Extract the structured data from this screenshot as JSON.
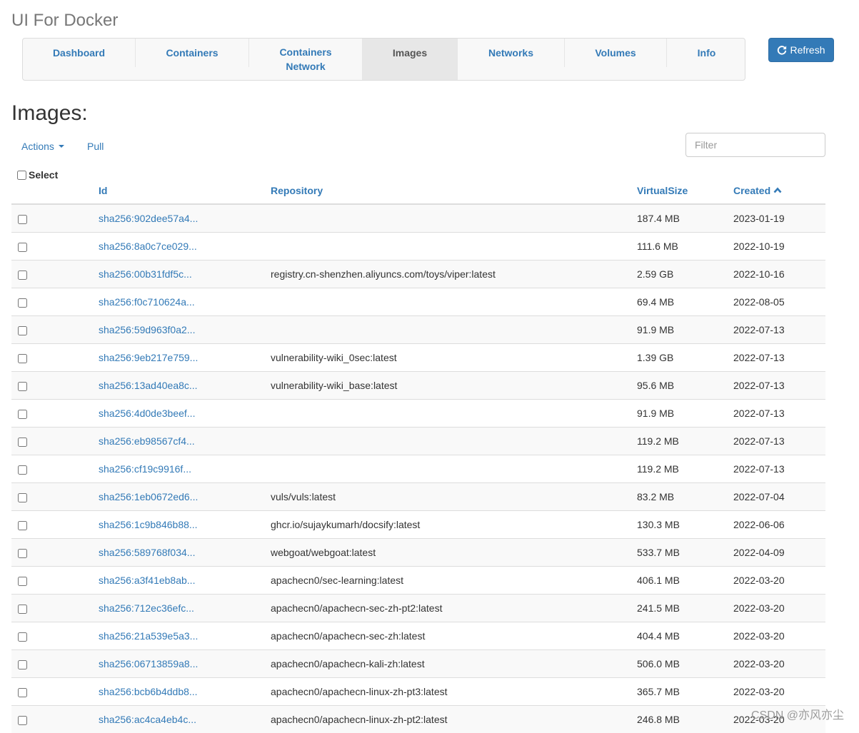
{
  "app": {
    "brand": "UI For Docker"
  },
  "nav": {
    "tabs": [
      {
        "label": "Dashboard"
      },
      {
        "label": "Containers"
      },
      {
        "label": "Containers Network"
      },
      {
        "label": "Images"
      },
      {
        "label": "Networks"
      },
      {
        "label": "Volumes"
      },
      {
        "label": "Info"
      }
    ],
    "active": "Images",
    "refresh_label": "Refresh"
  },
  "page": {
    "title": "Images:"
  },
  "toolbar": {
    "actions_label": "Actions",
    "pull_label": "Pull",
    "filter_placeholder": "Filter"
  },
  "table": {
    "headers": {
      "select": "Select",
      "id": "Id",
      "repository": "Repository",
      "size": "VirtualSize",
      "created": "Created"
    },
    "sort": {
      "column": "Created",
      "direction": "ascending"
    },
    "rows": [
      {
        "id": "sha256:902dee57a4...",
        "repository": "",
        "size": "187.4 MB",
        "created": "2023-01-19"
      },
      {
        "id": "sha256:8a0c7ce029...",
        "repository": "",
        "size": "111.6 MB",
        "created": "2022-10-19"
      },
      {
        "id": "sha256:00b31fdf5c...",
        "repository": "registry.cn-shenzhen.aliyuncs.com/toys/viper:latest",
        "size": "2.59 GB",
        "created": "2022-10-16"
      },
      {
        "id": "sha256:f0c710624a...",
        "repository": "",
        "size": "69.4 MB",
        "created": "2022-08-05"
      },
      {
        "id": "sha256:59d963f0a2...",
        "repository": "",
        "size": "91.9 MB",
        "created": "2022-07-13"
      },
      {
        "id": "sha256:9eb217e759...",
        "repository": "vulnerability-wiki_0sec:latest",
        "size": "1.39 GB",
        "created": "2022-07-13"
      },
      {
        "id": "sha256:13ad40ea8c...",
        "repository": "vulnerability-wiki_base:latest",
        "size": "95.6 MB",
        "created": "2022-07-13"
      },
      {
        "id": "sha256:4d0de3beef...",
        "repository": "",
        "size": "91.9 MB",
        "created": "2022-07-13"
      },
      {
        "id": "sha256:eb98567cf4...",
        "repository": "",
        "size": "119.2 MB",
        "created": "2022-07-13"
      },
      {
        "id": "sha256:cf19c9916f...",
        "repository": "",
        "size": "119.2 MB",
        "created": "2022-07-13"
      },
      {
        "id": "sha256:1eb0672ed6...",
        "repository": "vuls/vuls:latest",
        "size": "83.2 MB",
        "created": "2022-07-04"
      },
      {
        "id": "sha256:1c9b846b88...",
        "repository": "ghcr.io/sujaykumarh/docsify:latest",
        "size": "130.3 MB",
        "created": "2022-06-06"
      },
      {
        "id": "sha256:589768f034...",
        "repository": "webgoat/webgoat:latest",
        "size": "533.7 MB",
        "created": "2022-04-09"
      },
      {
        "id": "sha256:a3f41eb8ab...",
        "repository": "apachecn0/sec-learning:latest",
        "size": "406.1 MB",
        "created": "2022-03-20"
      },
      {
        "id": "sha256:712ec36efc...",
        "repository": "apachecn0/apachecn-sec-zh-pt2:latest",
        "size": "241.5 MB",
        "created": "2022-03-20"
      },
      {
        "id": "sha256:21a539e5a3...",
        "repository": "apachecn0/apachecn-sec-zh:latest",
        "size": "404.4 MB",
        "created": "2022-03-20"
      },
      {
        "id": "sha256:06713859a8...",
        "repository": "apachecn0/apachecn-kali-zh:latest",
        "size": "506.0 MB",
        "created": "2022-03-20"
      },
      {
        "id": "sha256:bcb6b4ddb8...",
        "repository": "apachecn0/apachecn-linux-zh-pt3:latest",
        "size": "365.7 MB",
        "created": "2022-03-20"
      },
      {
        "id": "sha256:ac4ca4eb4c...",
        "repository": "apachecn0/apachecn-linux-zh-pt2:latest",
        "size": "246.8 MB",
        "created": "2022-03-20"
      }
    ]
  },
  "watermark": "CSDN @亦风亦尘",
  "colors": {
    "link": "#337ab7",
    "primary_button": "#337ab7",
    "nav_bg": "#f8f8f8",
    "active_tab_bg": "#e7e7e7",
    "stripe": "#f9f9f9"
  }
}
